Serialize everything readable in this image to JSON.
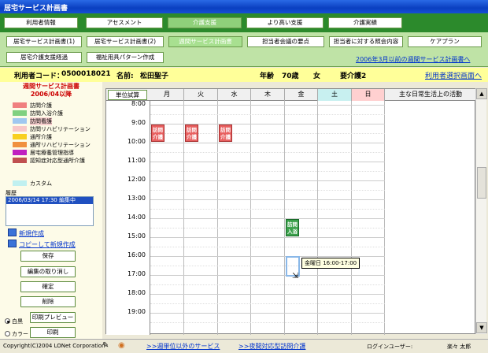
{
  "window": {
    "title": "居宅サービス計画書"
  },
  "top_tabs": [
    {
      "label": "利用者情報"
    },
    {
      "label": "アセスメント"
    },
    {
      "label": "介護支援"
    },
    {
      "label": "より高い支援"
    },
    {
      "label": "介護実績"
    }
  ],
  "sub_tabs": [
    {
      "label": "居宅サービス計画書(1)"
    },
    {
      "label": "居宅サービス計画書(2)"
    },
    {
      "label": "週間サービス計画書"
    },
    {
      "label": "担当者会議の要点"
    },
    {
      "label": "担当者に対する照会内容"
    },
    {
      "label": "ケアプラン"
    },
    {
      "label": "居宅介護支援経過"
    },
    {
      "label": "福祉用具パターン作成"
    }
  ],
  "prev_link": "2006年3月以前の週間サービス計画書へ",
  "info": {
    "user_code_label": "利用者コード：",
    "user_code": "0500018021",
    "name_label": "名前:",
    "name": "松田聖子",
    "age_label": "年齢",
    "age": "70歳",
    "sex": "女",
    "care_level": "要介護2",
    "select_link": "利用者選択画面へ"
  },
  "left": {
    "title": "週間サービス計画書",
    "period": "2006/04以降",
    "legend": [
      {
        "label": "訪問介護",
        "color": "#f08080"
      },
      {
        "label": "訪問入浴介護",
        "color": "#80d080"
      },
      {
        "label": "訪問看護",
        "color": "#a0c8f0"
      },
      {
        "label": "訪問リハビリテーション",
        "color": "#f8c8c8"
      },
      {
        "label": "通所介護",
        "color": "#f8d020"
      },
      {
        "label": "通所リハビリテーション",
        "color": "#f09040"
      },
      {
        "label": "居宅療養管理指導",
        "color": "#c020c0"
      },
      {
        "label": "認知症対応型通所介護",
        "color": "#c05050"
      },
      {
        "label": "カスタム",
        "color": "#c0f0f0"
      }
    ],
    "history_label": "履歴",
    "history_items": [
      "2006/03/14 17:30 編集中"
    ],
    "new_link": "新規作成",
    "copy_link": "コピーして新規作成",
    "buttons": {
      "save": "保存",
      "undo": "編集の取り消し",
      "confirm": "確定",
      "delete": "削除",
      "print_preview": "印刷プレビュー",
      "print": "印刷"
    },
    "radio_bw": "白黒",
    "radio_color": "カラー"
  },
  "calendar": {
    "unit_button": "単位試算",
    "days": [
      "月",
      "火",
      "水",
      "木",
      "金",
      "土",
      "日"
    ],
    "activity_header": "主な日常生活上の活動",
    "times": [
      "8:00",
      "9:00",
      "10:00",
      "11:00",
      "12:00",
      "13:00",
      "14:00",
      "15:00",
      "16:00",
      "17:00",
      "18:00",
      "19:00"
    ],
    "events": [
      {
        "day": 0,
        "start": "9:00",
        "label": "訪問介護",
        "line1": "訪問",
        "line2": "介護",
        "type": "red"
      },
      {
        "day": 1,
        "start": "9:00",
        "label": "訪問介護",
        "line1": "訪問",
        "line2": "介護",
        "type": "red"
      },
      {
        "day": 2,
        "start": "9:00",
        "label": "訪問介護",
        "line1": "訪問",
        "line2": "介護",
        "type": "red"
      },
      {
        "day": 4,
        "start": "14:00",
        "label": "訪問入浴",
        "line1": "訪問",
        "line2": "入浴",
        "type": "green"
      }
    ],
    "tooltip": "金曜日 16:00-17:00"
  },
  "status": {
    "copyright": "Copyright(C)2004 LONet Corporation",
    "link1": ">>週単位以外のサービス",
    "link2": ">>夜間対応型訪問介護",
    "login_label": "ログインユーザー:",
    "login_user": "楽々 太郎"
  },
  "colors": {
    "tab_bar": "#2c8a2c",
    "subtab_bar": "#bfe3a6",
    "info_bar": "#ffff99",
    "saturday": "#c8f0f0",
    "sunday": "#ffd0d0"
  }
}
